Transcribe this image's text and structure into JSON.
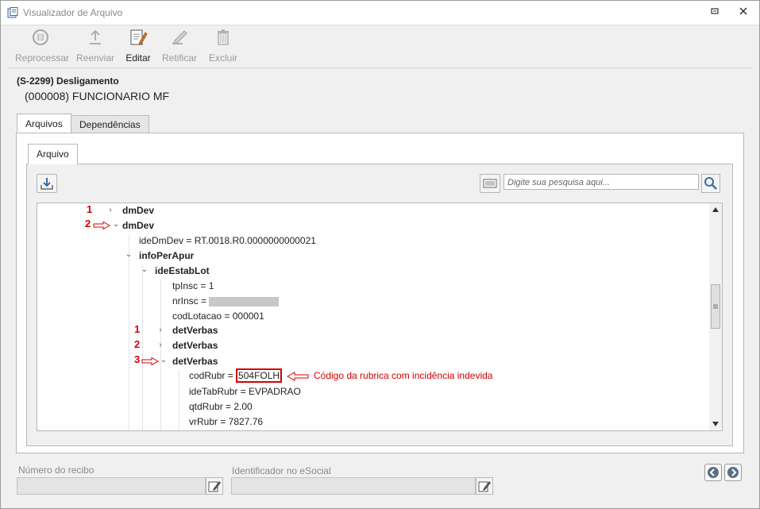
{
  "window": {
    "title": "Visualizador de Arquivo"
  },
  "toolbar": {
    "reprocessar": "Reprocessar",
    "reenviar": "Reenviar",
    "editar": "Editar",
    "retificar": "Retificar",
    "excluir": "Excluir"
  },
  "header": {
    "title": "(S-2299) Desligamento",
    "subtitle": "(000008) FUNCIONARIO MF"
  },
  "tabs": {
    "arquivos": "Arquivos",
    "dependencias": "Dependências",
    "arquivo": "Arquivo"
  },
  "search": {
    "placeholder": "Digite sua pesquisa aqui..."
  },
  "tree": {
    "dmDev1": "dmDev",
    "dmDev2": "dmDev",
    "ideDmDev": "ideDmDev = RT.0018.R0.0000000000021",
    "infoPerApur": "infoPerApur",
    "ideEstabLot": "ideEstabLot",
    "tpInsc": "tpInsc = 1",
    "nrInsc": "nrInsc = ",
    "codLotacao": "codLotacao = 000001",
    "detVerbas1": "detVerbas",
    "detVerbas2": "detVerbas",
    "detVerbas3": "detVerbas",
    "codRubr_prefix": "codRubr = ",
    "codRubr_value": "504FOLH",
    "ideTabRubr": "ideTabRubr = EVPADRAO",
    "qtdRubr": "qtdRubr = 2.00",
    "vrRubr": "vrRubr = 7827.76"
  },
  "annotations": {
    "n1a": "1",
    "n2a": "2",
    "n1b": "1",
    "n2b": "2",
    "n3b": "3",
    "rubrica_note": "Código da rubrica com incidência indevida"
  },
  "footer": {
    "recibo_label": "Número do recibo",
    "esocial_label": "Identificador no eSocial"
  },
  "colors": {
    "accent_red": "#d40000"
  }
}
